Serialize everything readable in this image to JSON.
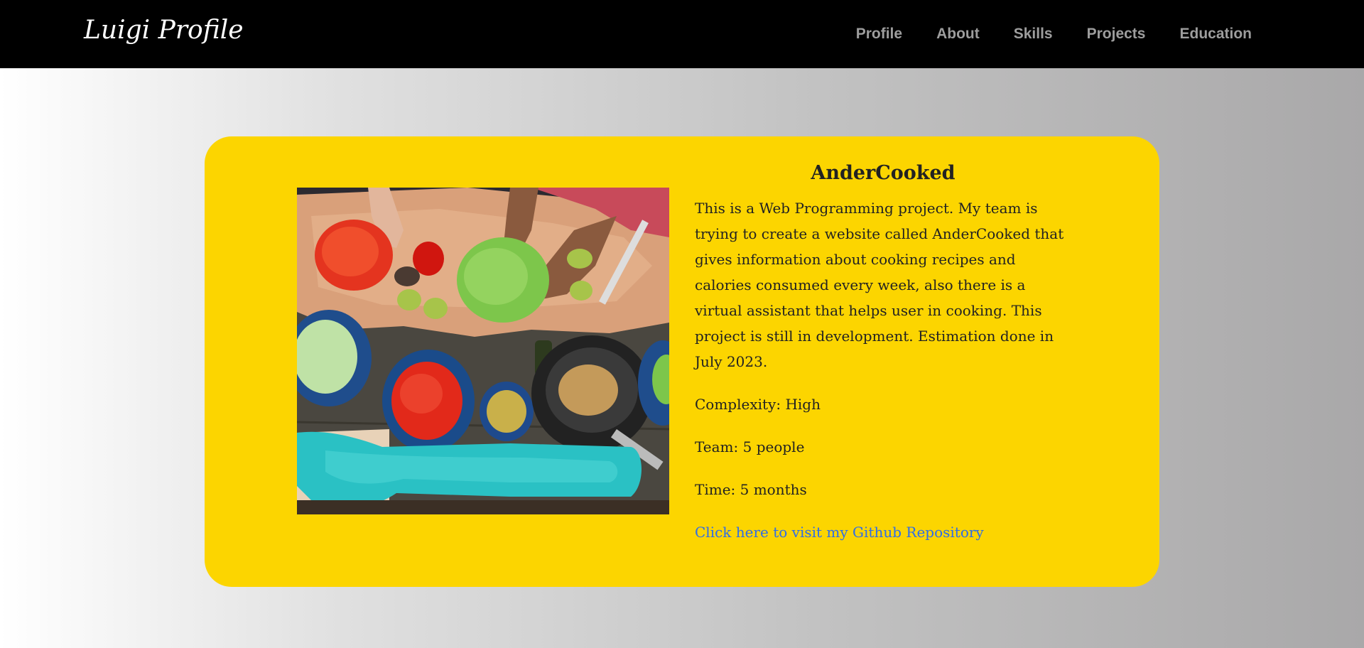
{
  "navbar": {
    "brand": "Luigi Profile",
    "links": [
      {
        "label": "Profile"
      },
      {
        "label": "About"
      },
      {
        "label": "Skills"
      },
      {
        "label": "Projects"
      },
      {
        "label": "Education"
      }
    ]
  },
  "project": {
    "title": "AnderCooked",
    "description": "This is a Web Programming project. My team is trying to create a website called AnderCooked that gives information about cooking recipes and calories consumed every week, also there is a virtual assistant that helps user in cooking. This project is still in development. Estimation done in July 2023.",
    "complexity": "Complexity: High",
    "team": "Team: 5 people",
    "time": "Time: 5 months",
    "link_text": "Click here to visit my Github Repository",
    "image_icon": "cooking-photo"
  },
  "colors": {
    "navbar_bg": "#000000",
    "card_bg": "#fcd500",
    "link": "#2f6de8",
    "nav_text": "#9d9d9d"
  }
}
